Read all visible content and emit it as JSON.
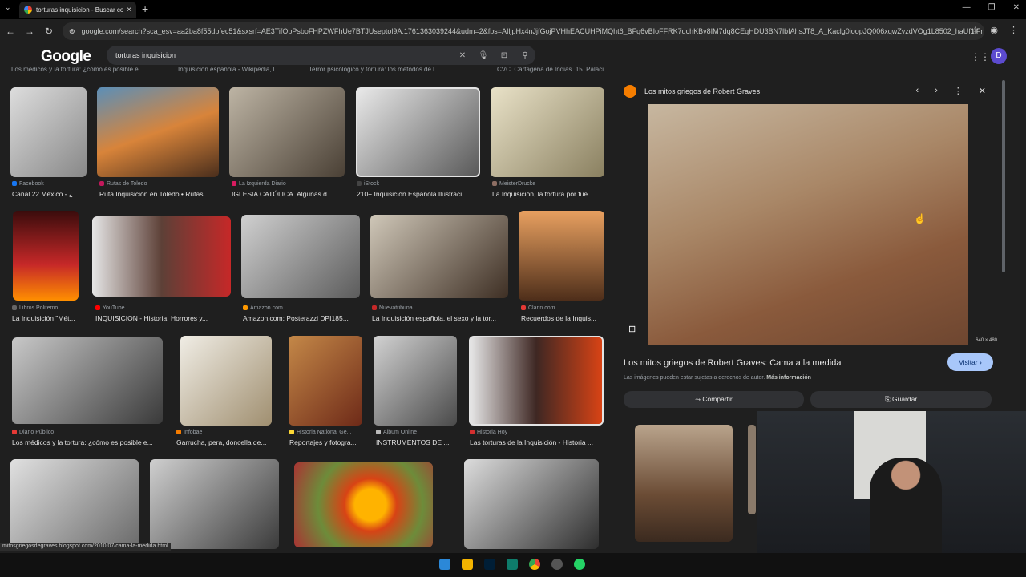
{
  "browser": {
    "tab_title": "torturas inquisicion - Buscar con Google",
    "url": "google.com/search?sca_esv=aa2ba8f55dbfec51&sxsrf=AE3TifObPsboFHPZWFhUe7BTJUseptol9A:1761363039244&udm=2&fbs=AIljpHx4nJjfGojPVHhEACUHPiMQht6_BFq6vBIoFFRK7qchKBv8IM7dq8CEqHDU3BN7lbIAhsJT8_A_Kaclg0ioopJQ006xqwZvzdVOg1L8502_haUf1lFnFypIr0l5OD..."
  },
  "search": {
    "query": "torturas inquisicion",
    "logo": "Google",
    "avatar_initial": "D"
  },
  "top_row": [
    "Los médicos y la tortura: ¿cómo es posible e...",
    "Inquisición española - Wikipedia, l...",
    "Terror psicológico y tortura: los métodos de l...",
    "CVC. Cartagena de Indias. 15. Palaci..."
  ],
  "results": [
    {
      "source": "Facebook",
      "title": "Canal 22 México - ¿...",
      "color": "#1877f2"
    },
    {
      "source": "Rutas de Toledo",
      "title": "Ruta Inquisición en Toledo • Rutas...",
      "color": "#c2185b"
    },
    {
      "source": "La Izquierda Diario",
      "title": "IGLESIA CATÓLICA. Algunas d...",
      "color": "#d81b60"
    },
    {
      "source": "iStock",
      "title": "210+ Inquisición Española Ilustraci...",
      "color": "#444"
    },
    {
      "source": "MeisterDrucke",
      "title": "La Inquisición, la tortura por fue...",
      "color": "#8d6e63"
    },
    {
      "source": "Libros Polifemo",
      "title": "La Inquisición \"Mét...",
      "color": "#666"
    },
    {
      "source": "YouTube",
      "title": "INQUISICION - Historia, Horrores y...",
      "color": "#ff0000"
    },
    {
      "source": "Amazon.com",
      "title": "Amazon.com: Posterazzi DPI185...",
      "color": "#ff9900"
    },
    {
      "source": "Nuevatribuna",
      "title": "La Inquisición española, el sexo y la tor...",
      "color": "#c62828"
    },
    {
      "source": "Clarin.com",
      "title": "Recuerdos de la Inquis...",
      "color": "#e53935"
    },
    {
      "source": "Diario Público",
      "title": "Los médicos y la tortura: ¿cómo es posible e...",
      "color": "#e53935"
    },
    {
      "source": "Infobae",
      "title": "Garrucha, pera, doncella de...",
      "color": "#f57c00"
    },
    {
      "source": "Historia National Ge...",
      "title": "Reportajes y fotogra...",
      "color": "#fdd835"
    },
    {
      "source": "Album Online",
      "title": "INSTRUMENTOS DE ...",
      "color": "#bbb"
    },
    {
      "source": "Historia Hoy",
      "title": "Las torturas de la Inquisición - Historia ...",
      "color": "#d32f2f"
    }
  ],
  "panel": {
    "site": "Los mitos griegos de Robert Graves",
    "title": "Los mitos griegos de Robert Graves: Cama a la medida",
    "copyright": "Las imágenes pueden estar sujetas a derechos de autor.",
    "more_info": "Más información",
    "visit": "Visitar",
    "share": "Compartir",
    "save": "Guardar",
    "dimensions": "640 × 480"
  },
  "status_url": "mitosgriegosdegraves.blogspot.com/2010/07/cama-la-medida.html"
}
